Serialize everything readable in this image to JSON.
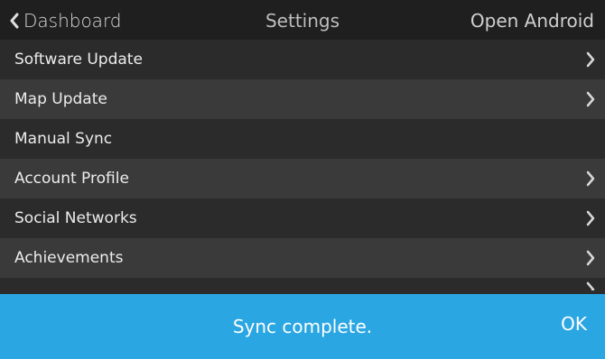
{
  "header": {
    "back_label": "Dashboard",
    "title": "Settings",
    "right_action": "Open Android"
  },
  "settings_list": {
    "items": [
      {
        "label": "Software Update",
        "has_chevron": true
      },
      {
        "label": "Map Update",
        "has_chevron": true
      },
      {
        "label": "Manual Sync",
        "has_chevron": false
      },
      {
        "label": "Account Profile",
        "has_chevron": true
      },
      {
        "label": "Social Networks",
        "has_chevron": true
      },
      {
        "label": "Achievements",
        "has_chevron": true
      }
    ]
  },
  "toast": {
    "message": "Sync complete.",
    "ok_label": "OK",
    "color": "#2aa6e3"
  },
  "icons": {
    "back": "chevron-left-icon",
    "row": "chevron-right-icon"
  }
}
